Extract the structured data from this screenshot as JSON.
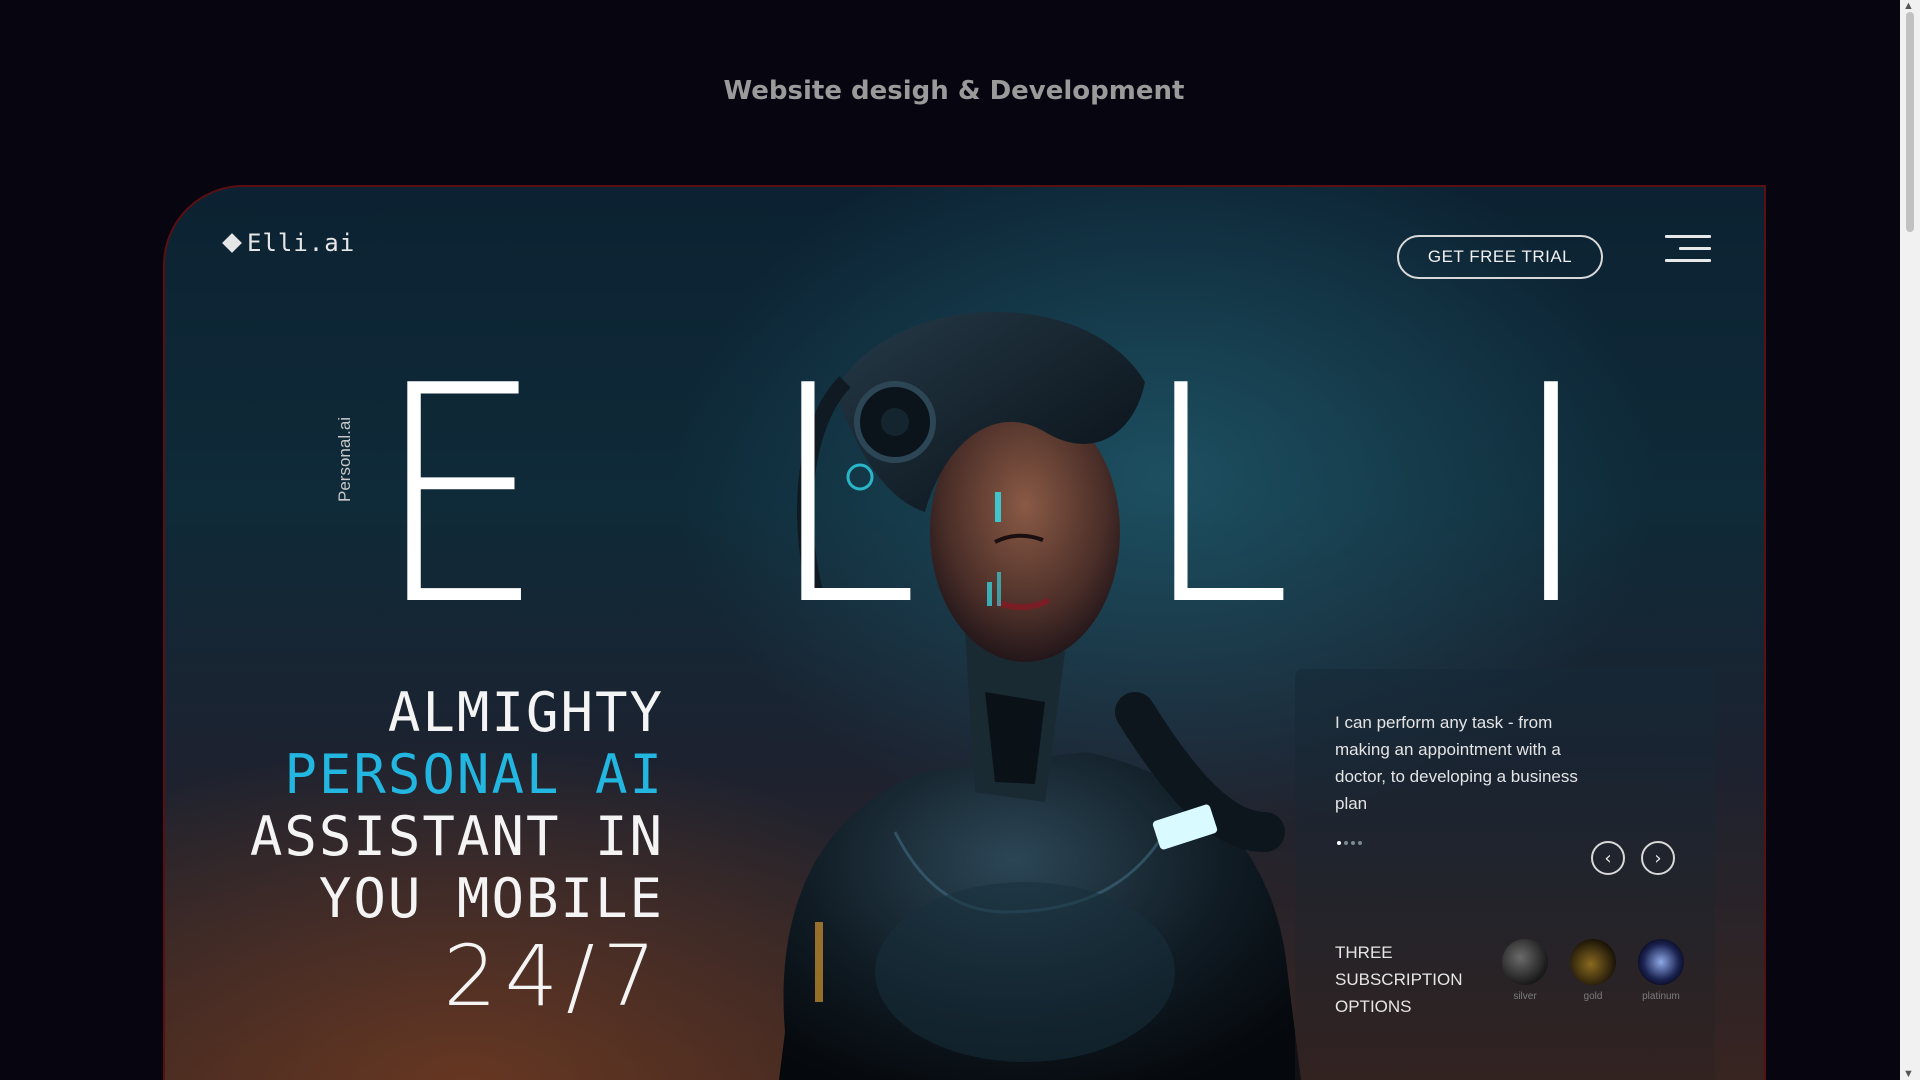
{
  "page_caption": "Website desigh & Development",
  "site": {
    "logo_text": "Elli.ai",
    "cta_label": "GET FREE TRIAL",
    "menu_icon": "hamburger-menu-icon",
    "vertical_label": "Personal.ai"
  },
  "hero": {
    "big_letters": [
      "E",
      "L",
      "L",
      "I"
    ],
    "headline_line1": "ALMIGHTY",
    "headline_line2": "PERSONAL AI",
    "headline_line3": "ASSISTANT IN",
    "headline_line4": "YOU MOBILE",
    "hours": "24/7",
    "accent_color": "#22b6e0"
  },
  "info_card": {
    "text": "I can perform any task - from making an appointment with a doctor, to developing a business plan",
    "slide_count": 4,
    "active_slide": 1,
    "prev_icon": "chevron-left-icon",
    "next_icon": "chevron-right-icon",
    "prev_glyph": "‹",
    "next_glyph": "›"
  },
  "subscriptions": {
    "label_line1": "THREE",
    "label_line2": "SUBSCRIPTION",
    "label_line3": "OPTIONS",
    "tiers": [
      {
        "name": "silver"
      },
      {
        "name": "gold"
      },
      {
        "name": "platinum"
      }
    ]
  }
}
